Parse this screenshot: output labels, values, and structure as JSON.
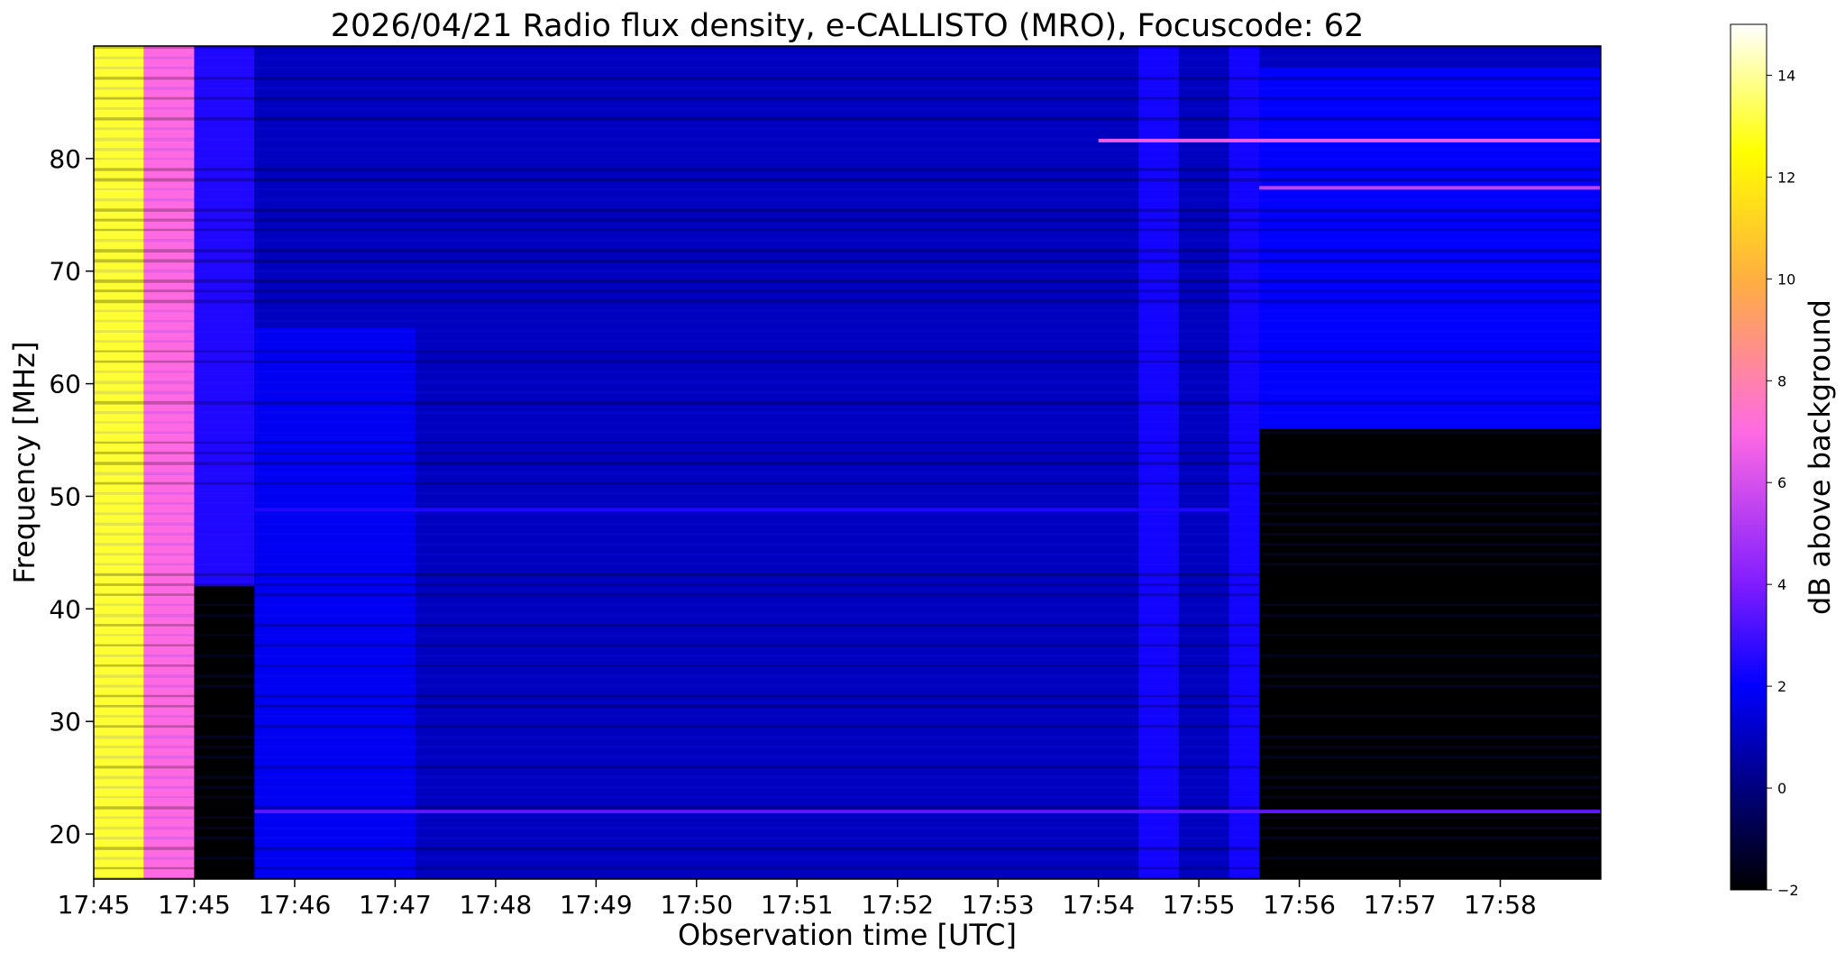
{
  "chart_data": {
    "type": "heatmap",
    "title": "2026/04/21  Radio flux density, e-CALLISTO (MRO), Focuscode: 62",
    "xlabel": "Observation time [UTC]",
    "ylabel": "Frequency [MHz]",
    "colorbar_label": "dB above background",
    "x_tick_labels": [
      "17:45",
      "17:45",
      "17:46",
      "17:47",
      "17:48",
      "17:49",
      "17:50",
      "17:51",
      "17:52",
      "17:53",
      "17:54",
      "17:55",
      "17:56",
      "17:57",
      "17:58"
    ],
    "x_range_minutes": [
      0,
      15
    ],
    "y_ticks": [
      20,
      30,
      40,
      50,
      60,
      70,
      80
    ],
    "y_tick_labels": [
      "20",
      "30",
      "40",
      "50",
      "60",
      "70",
      "80"
    ],
    "ylim": [
      16,
      90
    ],
    "colorbar_ticks": [
      -2,
      0,
      2,
      4,
      6,
      8,
      10,
      12,
      14
    ],
    "colorbar_tick_labels": [
      "−2",
      "0",
      "2",
      "4",
      "6",
      "8",
      "10",
      "12",
      "14"
    ],
    "clim": [
      -2,
      15
    ],
    "colormap": "gnuplot2",
    "colormap_stops": [
      "#000000",
      "#00007f",
      "#0000ff",
      "#7f1cff",
      "#ff6ae3",
      "#ffaf3f",
      "#ffff00",
      "#ffffff"
    ],
    "regions": [
      {
        "t": [
          0.0,
          0.5
        ],
        "f": [
          16,
          90
        ],
        "db": 13,
        "note": "saturated start"
      },
      {
        "t": [
          0.5,
          1.0
        ],
        "f": [
          16,
          90
        ],
        "db": 7
      },
      {
        "t": [
          1.0,
          1.6
        ],
        "f": [
          42,
          90
        ],
        "db": 2.5
      },
      {
        "t": [
          1.0,
          1.6
        ],
        "f": [
          16,
          42
        ],
        "db": -2
      },
      {
        "t": [
          1.6,
          15.0
        ],
        "f": [
          16,
          90
        ],
        "db": 1.0,
        "note": "background"
      },
      {
        "t": [
          1.6,
          3.2
        ],
        "f": [
          16,
          65
        ],
        "db": 1.8
      },
      {
        "t": [
          10.4,
          10.8
        ],
        "f": [
          16,
          90
        ],
        "db": 2.3
      },
      {
        "t": [
          11.3,
          11.6
        ],
        "f": [
          16,
          90
        ],
        "db": 2.3
      },
      {
        "t": [
          11.6,
          15.0
        ],
        "f": [
          16,
          56
        ],
        "db": -2
      },
      {
        "t": [
          11.6,
          15.0
        ],
        "f": [
          56,
          88
        ],
        "db": 2.0
      }
    ],
    "lines": [
      {
        "f": 81.6,
        "t": [
          10.0,
          15.0
        ],
        "db": 6.5
      },
      {
        "f": 77.4,
        "t": [
          11.6,
          15.0
        ],
        "db": 5.5
      },
      {
        "f": 22.0,
        "t": [
          1.6,
          15.0
        ],
        "db": 3.5
      },
      {
        "f": 48.8,
        "t": [
          1.6,
          11.3
        ],
        "db": 2.5
      }
    ]
  }
}
